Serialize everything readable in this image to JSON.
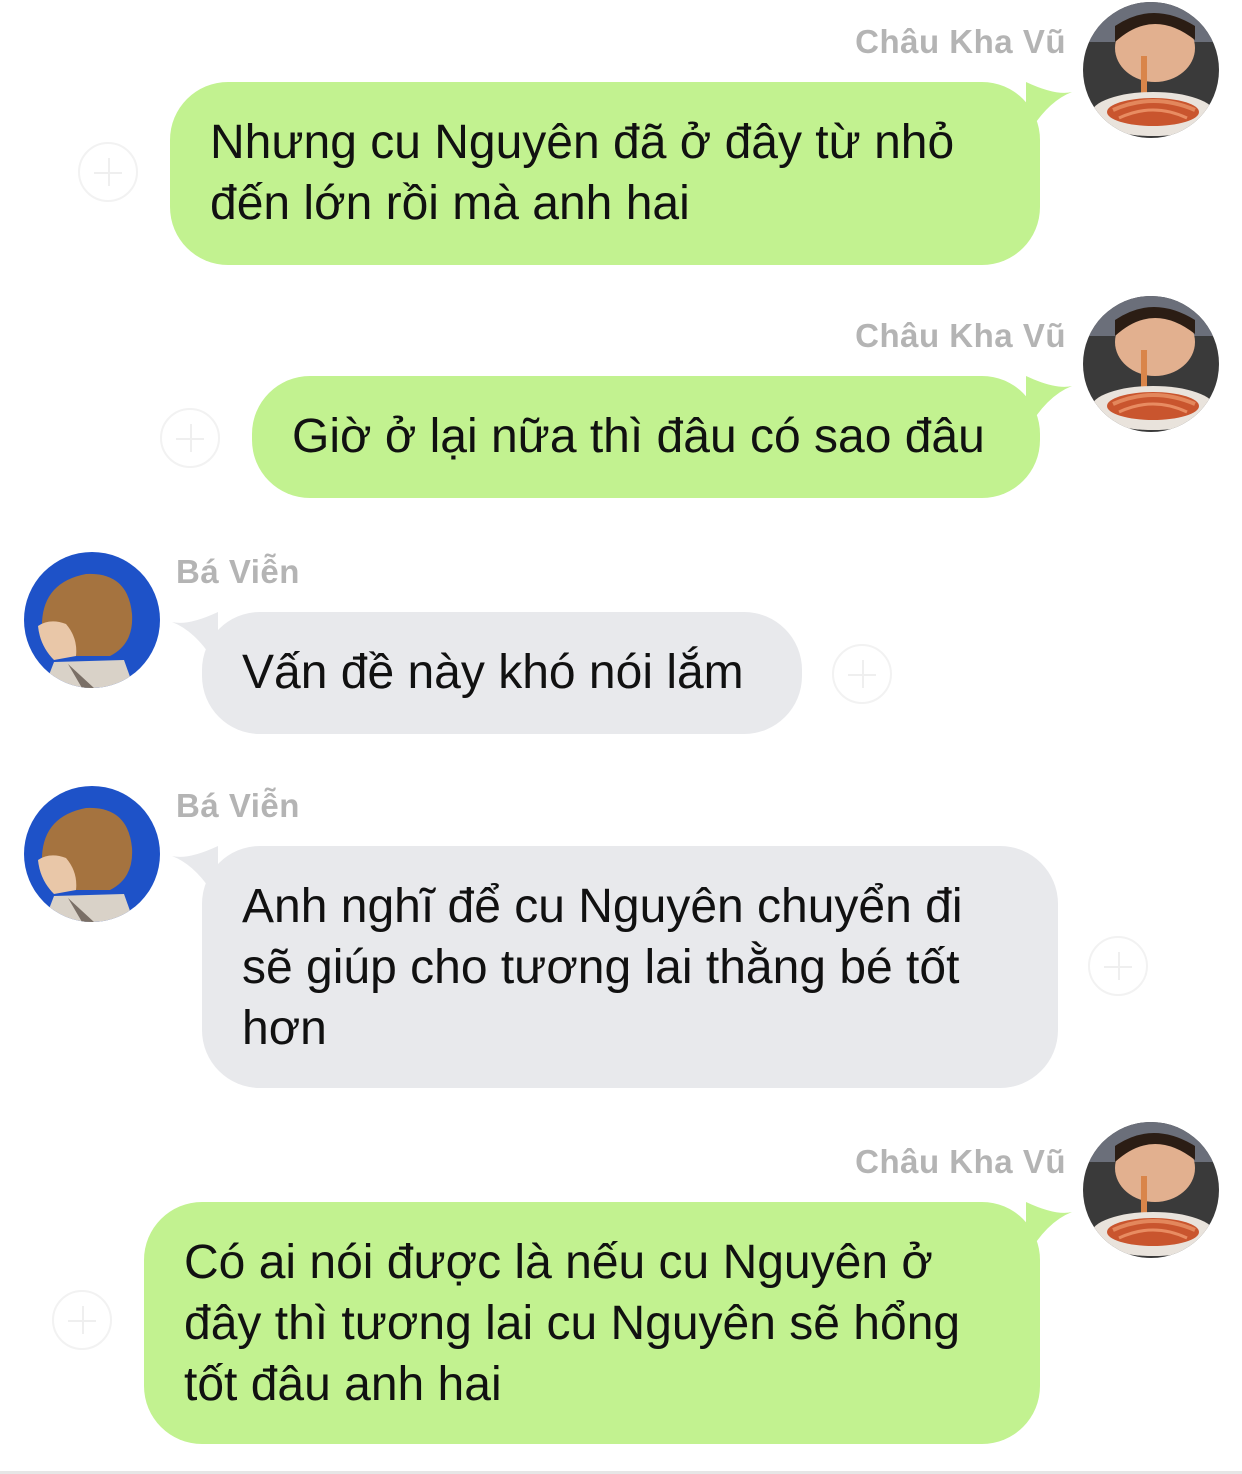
{
  "messages": [
    {
      "sender": "Châu Kha Vũ",
      "side": "right",
      "text": "Nhưng cu Nguyên đã ở đây từ nhỏ đến lớn rồi mà anh hai"
    },
    {
      "sender": "Châu Kha Vũ",
      "side": "right",
      "text": "Giờ ở lại nữa thì đâu có sao đâu"
    },
    {
      "sender": "Bá Viễn",
      "side": "left",
      "text": "Vấn đề này khó nói lắm"
    },
    {
      "sender": "Bá Viễn",
      "side": "left",
      "text": "Anh nghĩ để cu Nguyên chuyển đi sẽ giúp cho tương lai thằng bé tốt hơn"
    },
    {
      "sender": "Châu Kha Vũ",
      "side": "right",
      "text": "Có ai nói được là nếu cu Nguyên ở đây thì tương lai cu Nguyên sẽ hổng tốt đâu anh hai"
    }
  ],
  "colors": {
    "outgoing_bubble": "#c2f290",
    "incoming_bubble": "#e8e9ec",
    "sender_name": "#b4b4b4"
  },
  "icons": {
    "outgoing_avatar": "child-eating-spaghetti-avatar",
    "incoming_avatar": "man-profile-blue-avatar",
    "action": "plus-circle-icon"
  }
}
